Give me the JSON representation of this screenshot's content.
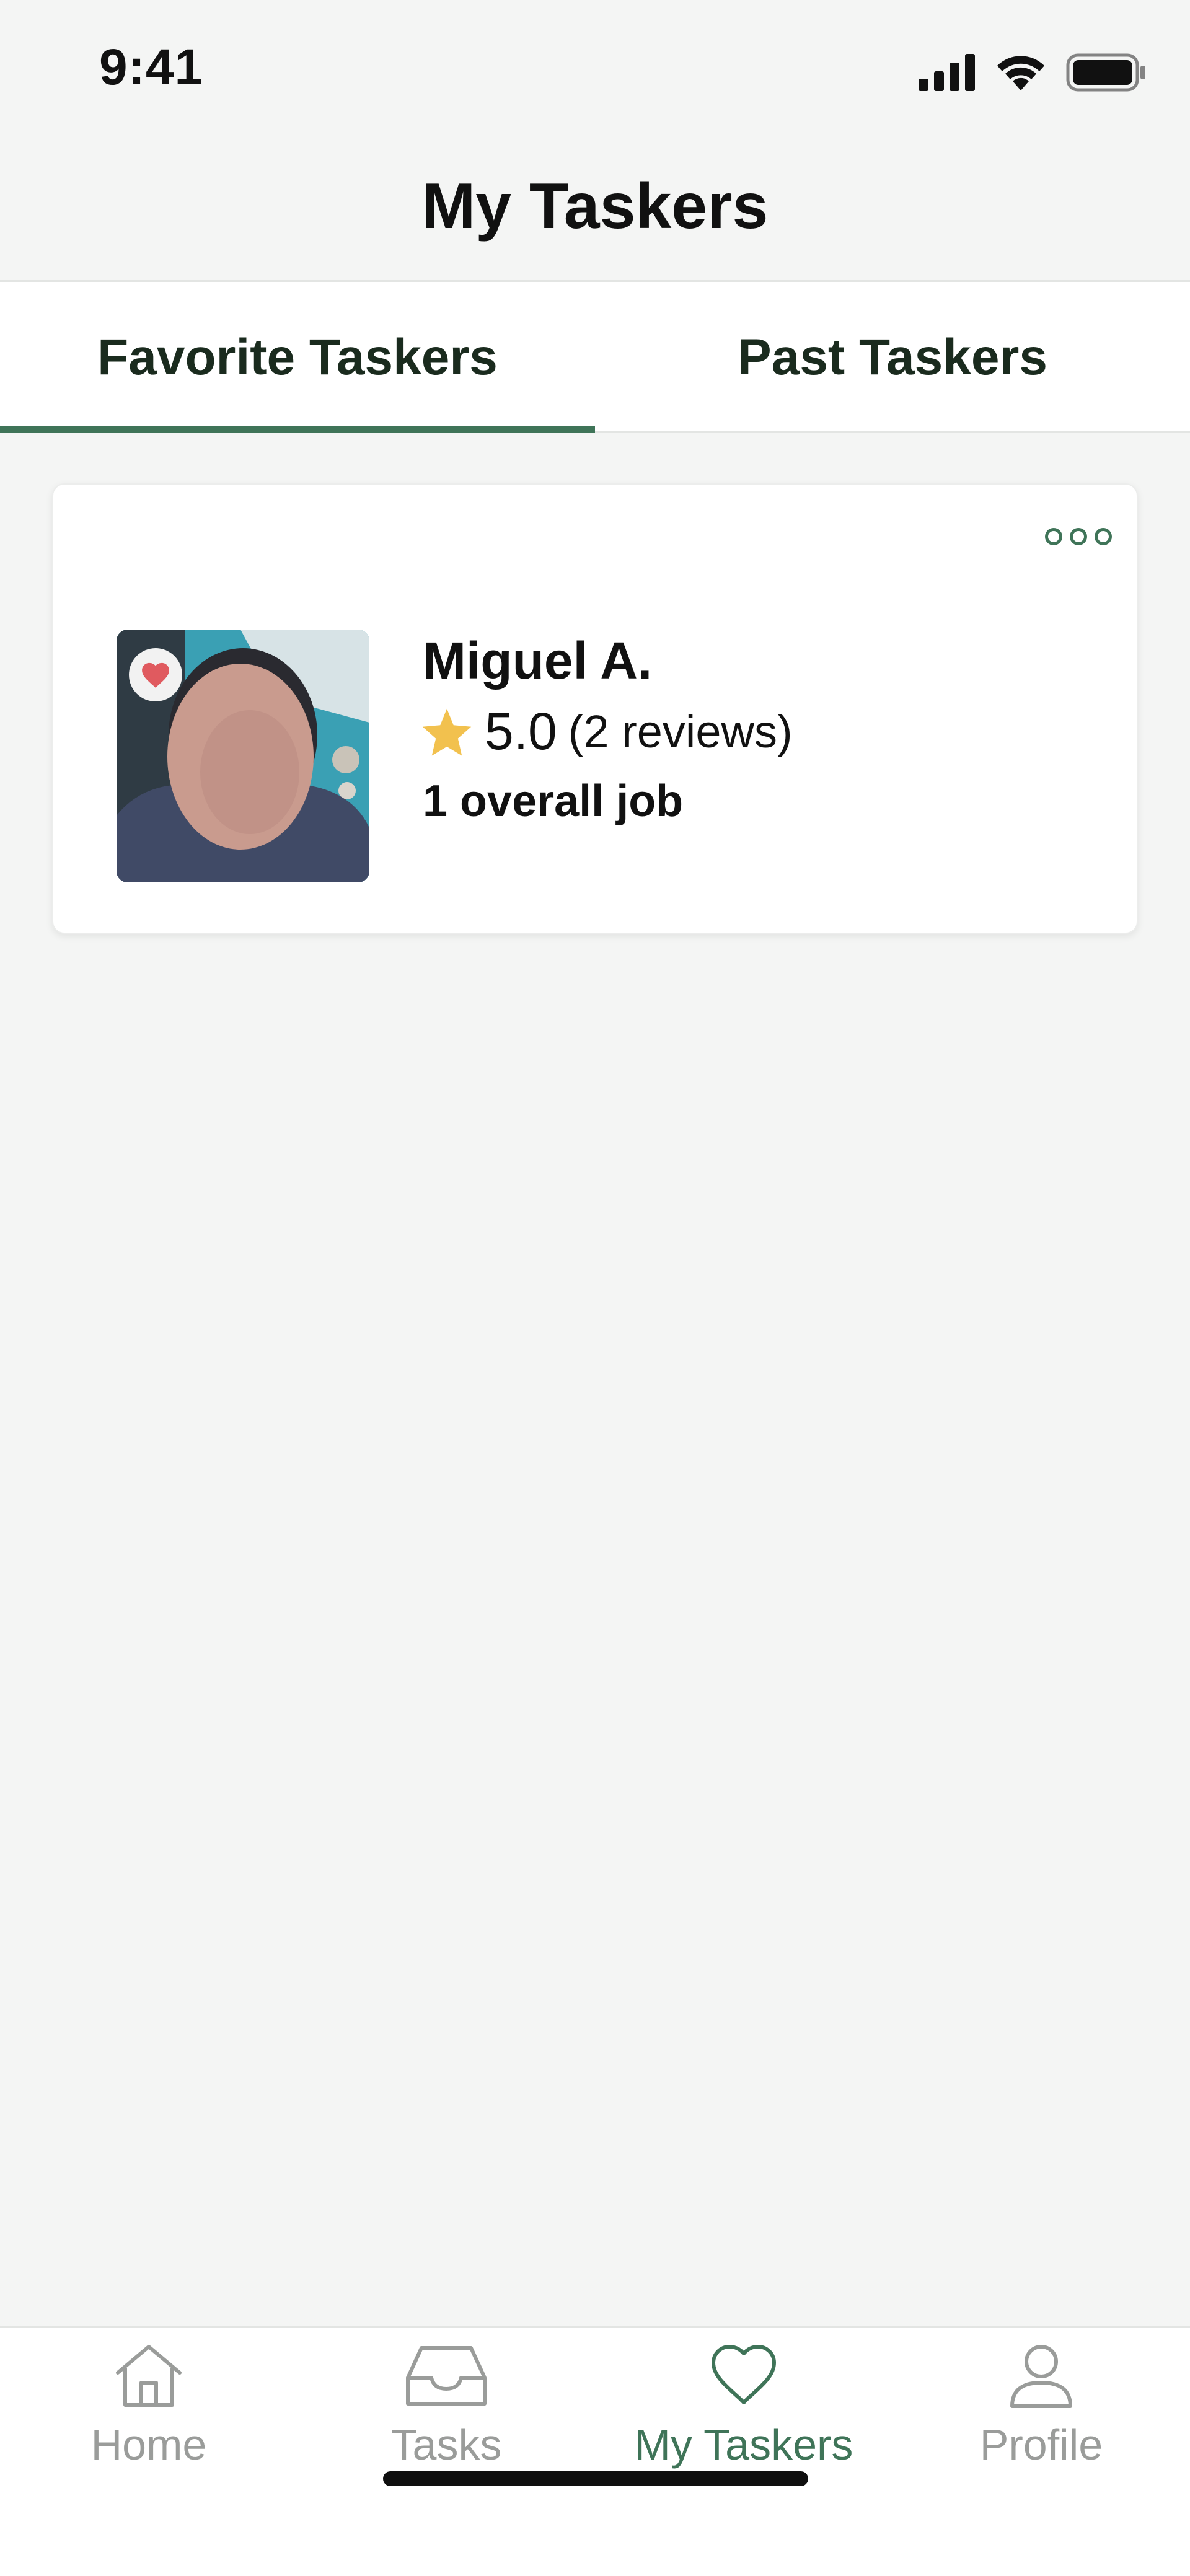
{
  "status_bar": {
    "time": "9:41"
  },
  "header": {
    "title": "My Taskers"
  },
  "tabs": [
    {
      "label": "Favorite Taskers",
      "active": true
    },
    {
      "label": "Past Taskers",
      "active": false
    }
  ],
  "tasker_card": {
    "name": "Miguel A.",
    "rating": "5.0",
    "reviews": "(2 reviews)",
    "jobs": "1 overall job"
  },
  "bottom_nav": [
    {
      "label": "Home",
      "icon": "home-icon",
      "active": false
    },
    {
      "label": "Tasks",
      "icon": "inbox-icon",
      "active": false
    },
    {
      "label": "My Taskers",
      "icon": "heart-icon",
      "active": true
    },
    {
      "label": "Profile",
      "icon": "person-icon",
      "active": false
    }
  ],
  "colors": {
    "accent": "#3F7458",
    "star": "#F2C14E",
    "heart": "#E05A5F",
    "inactive": "#9A9C9A",
    "background": "#F4F5F4"
  }
}
